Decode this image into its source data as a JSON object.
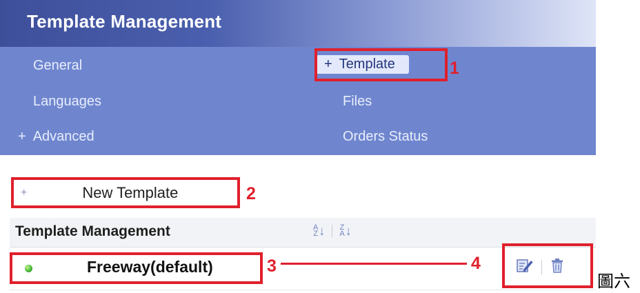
{
  "header": {
    "title": "Template Management"
  },
  "nav": {
    "items": [
      {
        "label": "General"
      },
      {
        "label": "Template",
        "prefix": "+",
        "active": true
      },
      {
        "label": "Languages"
      },
      {
        "label": "Files"
      },
      {
        "label": "Advanced",
        "prefix": "+"
      },
      {
        "label": "Orders Status"
      }
    ]
  },
  "new_template": {
    "prefix": "+",
    "label": "New Template"
  },
  "list": {
    "header": "Template Management",
    "sort_icons": [
      "sort-ascending-icon",
      "sort-descending-icon"
    ],
    "rows": [
      {
        "name": "Freeway(default)",
        "status": "active",
        "actions": [
          "edit-icon",
          "delete-icon"
        ]
      }
    ]
  },
  "annotations": {
    "markers": [
      "1",
      "2",
      "3",
      "4"
    ]
  },
  "caption": "圖六",
  "colors": {
    "header_dark": "#3e4f9a",
    "nav_bg": "#6f86cf",
    "annotation_red": "#e0202c",
    "status_green": "#46b83a",
    "icon_blue": "#7082c2"
  }
}
